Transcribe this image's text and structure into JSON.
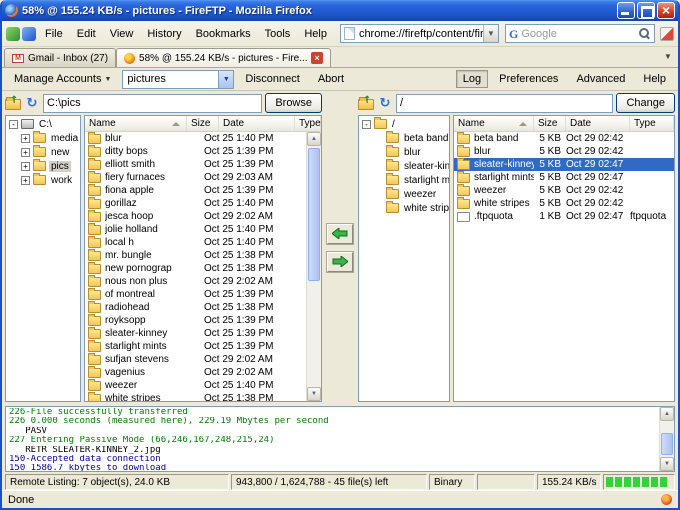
{
  "window": {
    "title": "58% @ 155.24 KB/s - pictures - FireFTP - Mozilla Firefox"
  },
  "menubar": {
    "items": [
      {
        "label": "File"
      },
      {
        "label": "Edit"
      },
      {
        "label": "View"
      },
      {
        "label": "History"
      },
      {
        "label": "Bookmarks"
      },
      {
        "label": "Tools"
      },
      {
        "label": "Help"
      }
    ]
  },
  "urlbar": {
    "value": "chrome://fireftp/content/fireftp.xul"
  },
  "search": {
    "value": "Google"
  },
  "tabs": [
    {
      "label": "Gmail - Inbox (27)"
    },
    {
      "label": "58% @ 155.24 KB/s - pictures - Fire..."
    }
  ],
  "ftp_toolbar": {
    "manage_accounts": "Manage Accounts",
    "account": "pictures",
    "disconnect": "Disconnect",
    "abort": "Abort",
    "log": "Log",
    "preferences": "Preferences",
    "advanced": "Advanced",
    "help": "Help"
  },
  "colors": {
    "selection": "#316ac5",
    "progress_green": "#35d435",
    "log_success": "#008000",
    "log_info": "#0000a0"
  },
  "local": {
    "path": "C:\\pics",
    "browse_label": "Browse",
    "columns": [
      "Name",
      "Size",
      "Date",
      "Type"
    ],
    "tree": [
      {
        "label": "C:\\",
        "exp": "-",
        "cls": "root"
      },
      {
        "label": "media",
        "exp": "+"
      },
      {
        "label": "new",
        "exp": "+"
      },
      {
        "label": "pics",
        "exp": "+",
        "cls": "open"
      },
      {
        "label": "work",
        "exp": "+"
      }
    ],
    "files": [
      {
        "name": "blur",
        "size": "",
        "date": "Oct 25 1:40 PM",
        "type": ""
      },
      {
        "name": "ditty bops",
        "size": "",
        "date": "Oct 25 1:39 PM",
        "type": ""
      },
      {
        "name": "elliott smith",
        "size": "",
        "date": "Oct 25 1:39 PM",
        "type": ""
      },
      {
        "name": "fiery furnaces",
        "size": "",
        "date": "Oct 29 2:03 AM",
        "type": ""
      },
      {
        "name": "fiona apple",
        "size": "",
        "date": "Oct 25 1:39 PM",
        "type": ""
      },
      {
        "name": "gorillaz",
        "size": "",
        "date": "Oct 25 1:40 PM",
        "type": ""
      },
      {
        "name": "jesca hoop",
        "size": "",
        "date": "Oct 29 2:02 AM",
        "type": ""
      },
      {
        "name": "jolie holland",
        "size": "",
        "date": "Oct 25 1:40 PM",
        "type": ""
      },
      {
        "name": "local h",
        "size": "",
        "date": "Oct 25 1:40 PM",
        "type": ""
      },
      {
        "name": "mr. bungle",
        "size": "",
        "date": "Oct 25 1:38 PM",
        "type": ""
      },
      {
        "name": "new pornographers",
        "size": "",
        "date": "Oct 25 1:38 PM",
        "type": ""
      },
      {
        "name": "nous non plus",
        "size": "",
        "date": "Oct 29 2:02 AM",
        "type": ""
      },
      {
        "name": "of montreal",
        "size": "",
        "date": "Oct 25 1:39 PM",
        "type": ""
      },
      {
        "name": "radiohead",
        "size": "",
        "date": "Oct 25 1:38 PM",
        "type": ""
      },
      {
        "name": "royksopp",
        "size": "",
        "date": "Oct 25 1:39 PM",
        "type": ""
      },
      {
        "name": "sleater-kinney",
        "size": "",
        "date": "Oct 25 1:39 PM",
        "type": ""
      },
      {
        "name": "starlight mints",
        "size": "",
        "date": "Oct 25 1:39 PM",
        "type": ""
      },
      {
        "name": "sufjan stevens",
        "size": "",
        "date": "Oct 29 2:02 AM",
        "type": ""
      },
      {
        "name": "vagenius",
        "size": "",
        "date": "Oct 29 2:02 AM",
        "type": ""
      },
      {
        "name": "weezer",
        "size": "",
        "date": "Oct 25 1:40 PM",
        "type": ""
      },
      {
        "name": "white stripes",
        "size": "",
        "date": "Oct 25 1:38 PM",
        "type": ""
      }
    ]
  },
  "remote": {
    "path": "/",
    "change_label": "Change",
    "columns": [
      "Name",
      "Size",
      "Date",
      "Type"
    ],
    "tree": [
      {
        "label": "/",
        "exp": "-",
        "cls": "root"
      },
      {
        "label": "beta band"
      },
      {
        "label": "blur"
      },
      {
        "label": "sleater-kinney"
      },
      {
        "label": "starlight mints"
      },
      {
        "label": "weezer"
      },
      {
        "label": "white stripes"
      }
    ],
    "files": [
      {
        "name": "beta band",
        "size": "5 KB",
        "date": "Oct 29 02:42",
        "type": ""
      },
      {
        "name": "blur",
        "size": "5 KB",
        "date": "Oct 29 02:42",
        "type": ""
      },
      {
        "name": "sleater-kinney",
        "size": "5 KB",
        "date": "Oct 29 02:47",
        "type": "",
        "cls": "selected"
      },
      {
        "name": "starlight mints",
        "size": "5 KB",
        "date": "Oct 29 02:47",
        "type": ""
      },
      {
        "name": "weezer",
        "size": "5 KB",
        "date": "Oct 29 02:42",
        "type": ""
      },
      {
        "name": "white stripes",
        "size": "5 KB",
        "date": "Oct 29 02:42",
        "type": ""
      },
      {
        "name": ".ftpquota",
        "size": "1 KB",
        "date": "Oct 29 02:47",
        "type": "ftpquota",
        "cls": "filetype"
      }
    ]
  },
  "log": {
    "lines": [
      {
        "text": "226-File successfully transferred",
        "color": "#008000"
      },
      {
        "text": "226 0.000 seconds (measured here), 229.19 Mbytes per second",
        "color": "#008000"
      },
      {
        "text": "   PASV",
        "color": "#000000"
      },
      {
        "text": "227 Entering Passive Mode (66,246,167,248,215,24)",
        "color": "#008000"
      },
      {
        "text": "   RETR SLEATER-KINNEY_2.jpg",
        "color": "#000000"
      },
      {
        "text": "150-Accepted data connection",
        "color": "#0000a0"
      },
      {
        "text": "150 1586.7 kbytes to download",
        "color": "#0000a0"
      }
    ]
  },
  "ftp_status": {
    "remote_listing": "Remote Listing: 7 object(s), 24.0 KB",
    "bytes": "943,800 / 1,624,788 - 45 file(s) left",
    "mode": "Binary",
    "speed": "155.24 KB/s"
  },
  "browser_status": {
    "text": "Done"
  }
}
